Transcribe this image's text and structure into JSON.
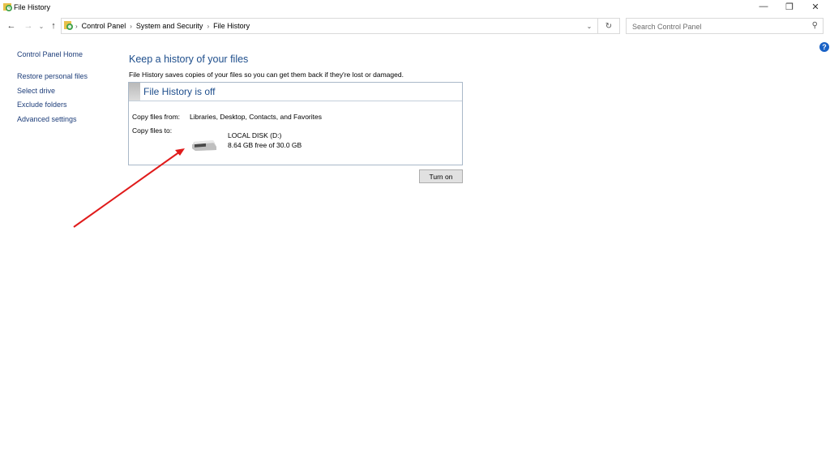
{
  "window": {
    "title": "File History",
    "controls": {
      "minimize": "—",
      "restore": "❐",
      "close": "✕"
    }
  },
  "nav": {
    "back": "←",
    "forward": "→",
    "recent": "⌄",
    "up": "↑"
  },
  "address": {
    "breadcrumbs": [
      "Control Panel",
      "System and Security",
      "File History"
    ],
    "separator": "›",
    "dropdown": "⌄",
    "refresh": "↻"
  },
  "search": {
    "placeholder": "Search Control Panel",
    "value": "",
    "icon": "⚲"
  },
  "help": {
    "label": "?"
  },
  "sidebar": {
    "home": "Control Panel Home",
    "items": [
      {
        "label": "Restore personal files"
      },
      {
        "label": "Select drive"
      },
      {
        "label": "Exclude folders"
      },
      {
        "label": "Advanced settings"
      }
    ]
  },
  "main": {
    "title": "Keep a history of your files",
    "description": "File History saves copies of your files so you can get them back if they're lost or damaged.",
    "panel": {
      "status": "File History is off",
      "copy_from_label": "Copy files from:",
      "copy_from_value": "Libraries, Desktop, Contacts, and Favorites",
      "copy_to_label": "Copy files to:",
      "drive_name": "LOCAL DISK (D:)",
      "drive_space": "8.64 GB free of 30.0 GB"
    },
    "turn_on_label": "Turn on"
  },
  "annotation": {
    "arrow_color": "#e01b1b"
  },
  "colors": {
    "link": "#1e3e7a",
    "heading": "#1e4e8c",
    "help": "#1a62c6"
  }
}
